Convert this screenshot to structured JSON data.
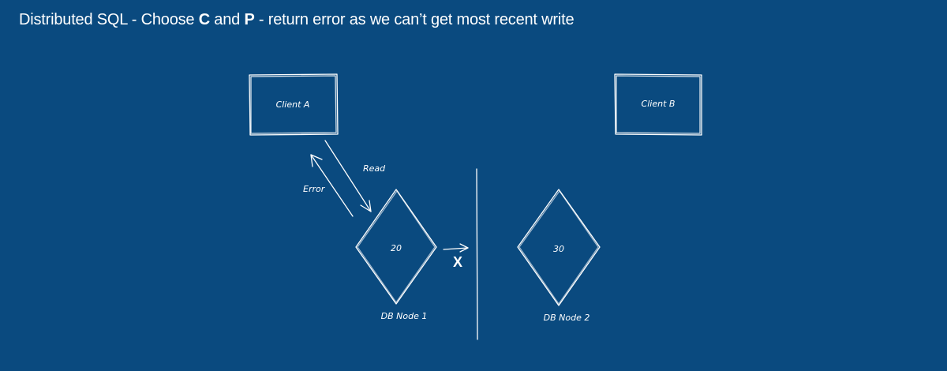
{
  "title": {
    "prefix": "Distributed SQL - Choose ",
    "c": "C",
    "and": " and ",
    "p": "P",
    "suffix": " - return error as we can’t get most recent write"
  },
  "diagram": {
    "client_a": "Client A",
    "client_b": "Client B",
    "read_label": "Read",
    "error_label": "Error",
    "node1_value": "20",
    "node2_value": "30",
    "node1_label": "DB Node 1",
    "node2_label": "DB Node 2",
    "blocked_mark": "X"
  }
}
